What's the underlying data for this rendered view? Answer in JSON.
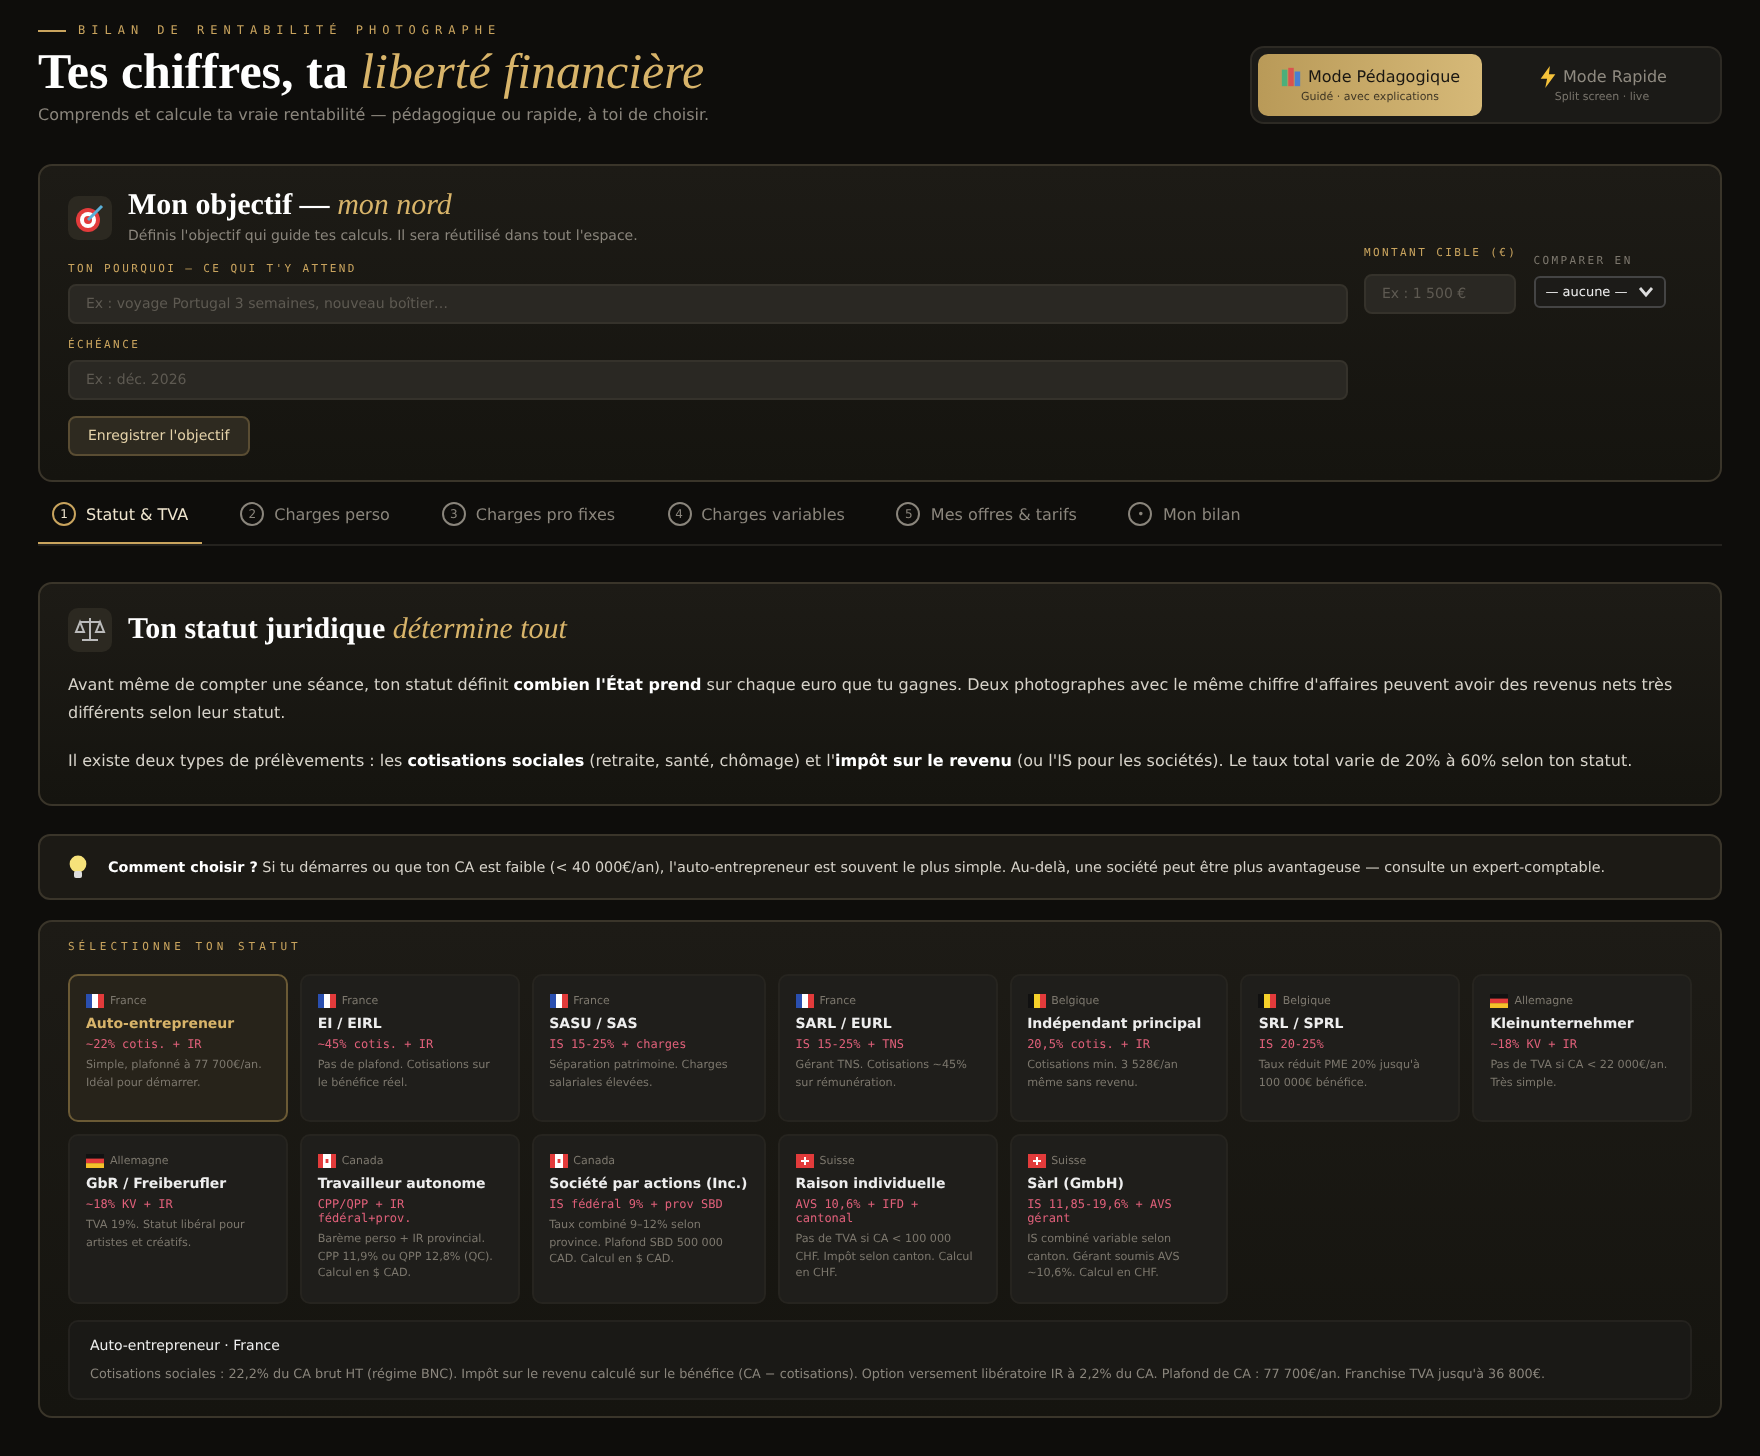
{
  "header": {
    "eyebrow": "BILAN DE RENTABILITÉ PHOTOGRAPHE",
    "title": "Tes chiffres, ta",
    "title_accent": "liberté financière",
    "subtitle": "Comprends et calcule ta vraie rentabilité — pédagogique ou rapide, à toi de choisir."
  },
  "modes": [
    {
      "kind": "book",
      "label": "Mode Pédagogique",
      "caption": "Guidé · avec explications",
      "selected": true
    },
    {
      "kind": "bolt",
      "label": "Mode Rapide",
      "caption": "Split screen · live",
      "selected": false
    }
  ],
  "objective": {
    "title": "Mon objectif —",
    "title_accent": "mon nord",
    "subtitle": "Définis l'objectif qui guide tes calculs. Il sera réutilisé dans tout l'espace.",
    "why_label": "TON POURQUOI — CE QUI T'Y ATTEND",
    "why_placeholder": "Ex : voyage Portugal 3 semaines, nouveau boîtier…",
    "amount_label": "MONTANT CIBLE (€)",
    "amount_placeholder": "Ex : 1 500 €",
    "compare_label": "COMPARER EN",
    "compare_value": "— aucune —",
    "deadline_label": "ÉCHÉANCE",
    "deadline_placeholder": "Ex : déc. 2026",
    "save": "Enregistrer l'objectif"
  },
  "tabs": [
    {
      "num": "1",
      "label": "Statut & TVA",
      "selected": true
    },
    {
      "num": "2",
      "label": "Charges perso",
      "selected": false
    },
    {
      "num": "3",
      "label": "Charges pro fixes",
      "selected": false
    },
    {
      "num": "4",
      "label": "Charges variables",
      "selected": false
    },
    {
      "num": "5",
      "label": "Mes offres & tarifs",
      "selected": false
    },
    {
      "num": "•",
      "label": "Mon bilan",
      "selected": false
    }
  ],
  "statut": {
    "title": "Ton statut juridique",
    "title_accent": "détermine tout",
    "paragraphs": [
      "Avant même de compter une séance, ton statut définit **combien l'État prend** sur chaque euro que tu gagnes. Deux photographes avec le même chiffre d'affaires peuvent avoir des revenus nets très différents selon leur statut.",
      "Il existe deux types de prélèvements : les **cotisations sociales** (retraite, santé, chômage) et l'**impôt sur le revenu** (ou l'IS pour les sociétés). Le taux total varie de 20% à 60% selon ton statut."
    ]
  },
  "tip": "**Comment choisir ?** Si tu démarres ou que ton CA est faible (< 40 000€/an), l'auto-entrepreneur est souvent le plus simple. Au-delà, une société peut être plus avantageuse — consulte un expert-comptable.",
  "selection": {
    "label": "SÉLECTIONNE TON STATUT",
    "cards": [
      {
        "kind": "fr",
        "country": "France",
        "name": "Auto-entrepreneur",
        "rate": "~22% cotis. + IR",
        "desc": "Simple, plafonné à 77 700€/an. Idéal pour démarrer.",
        "selected": true
      },
      {
        "kind": "fr",
        "country": "France",
        "name": "EI / EIRL",
        "rate": "~45% cotis. + IR",
        "desc": "Pas de plafond. Cotisations sur le bénéfice réel.",
        "selected": false
      },
      {
        "kind": "fr",
        "country": "France",
        "name": "SASU / SAS",
        "rate": "IS 15-25% + charges",
        "desc": "Séparation patrimoine. Charges salariales élevées.",
        "selected": false
      },
      {
        "kind": "fr",
        "country": "France",
        "name": "SARL / EURL",
        "rate": "IS 15-25% + TNS",
        "desc": "Gérant TNS. Cotisations ~45% sur rémunération.",
        "selected": false
      },
      {
        "kind": "be",
        "country": "Belgique",
        "name": "Indépendant principal",
        "rate": "20,5% cotis. + IR",
        "desc": "Cotisations min. 3 528€/an même sans revenu.",
        "selected": false
      },
      {
        "kind": "be",
        "country": "Belgique",
        "name": "SRL / SPRL",
        "rate": "IS 20-25%",
        "desc": "Taux réduit PME 20% jusqu'à 100 000€ bénéfice.",
        "selected": false
      },
      {
        "kind": "de",
        "country": "Allemagne",
        "name": "Kleinunternehmer",
        "rate": "~18% KV + IR",
        "desc": "Pas de TVA si CA < 22 000€/an. Très simple.",
        "selected": false
      },
      {
        "kind": "de",
        "country": "Allemagne",
        "name": "GbR / Freiberufler",
        "rate": "~18% KV + IR",
        "desc": "TVA 19%. Statut libéral pour artistes et créatifs.",
        "selected": false
      },
      {
        "kind": "ca",
        "country": "Canada",
        "name": "Travailleur autonome",
        "rate": "CPP/QPP + IR fédéral+prov.",
        "desc": "Barème perso + IR provincial. CPP 11,9% ou QPP 12,8% (QC). Calcul en $ CAD.",
        "selected": false
      },
      {
        "kind": "ca",
        "country": "Canada",
        "name": "Société par actions (Inc.)",
        "rate": "IS fédéral 9% + prov SBD",
        "desc": "Taux combiné 9–12% selon province. Plafond SBD 500 000 CAD. Calcul en $ CAD.",
        "selected": false
      },
      {
        "kind": "ch",
        "country": "Suisse",
        "name": "Raison individuelle",
        "rate": "AVS 10,6% + IFD + cantonal",
        "desc": "Pas de TVA si CA < 100 000 CHF. Impôt selon canton. Calcul en CHF.",
        "selected": false
      },
      {
        "kind": "ch",
        "country": "Suisse",
        "name": "Sàrl (GmbH)",
        "rate": "IS 11,85-19,6% + AVS gérant",
        "desc": "IS combiné variable selon canton. Gérant soumis AVS ~10,6%. Calcul en CHF.",
        "selected": false
      }
    ],
    "detail_title": "Auto-entrepreneur · France",
    "detail_text": "Cotisations sociales : 22,2% du CA brut HT (régime BNC). Impôt sur le revenu calculé sur le bénéfice (CA − cotisations). Option versement libératoire IR à 2,2% du CA. Plafond de CA : 77 700€/an. Franchise TVA jusqu'à 36 800€."
  }
}
